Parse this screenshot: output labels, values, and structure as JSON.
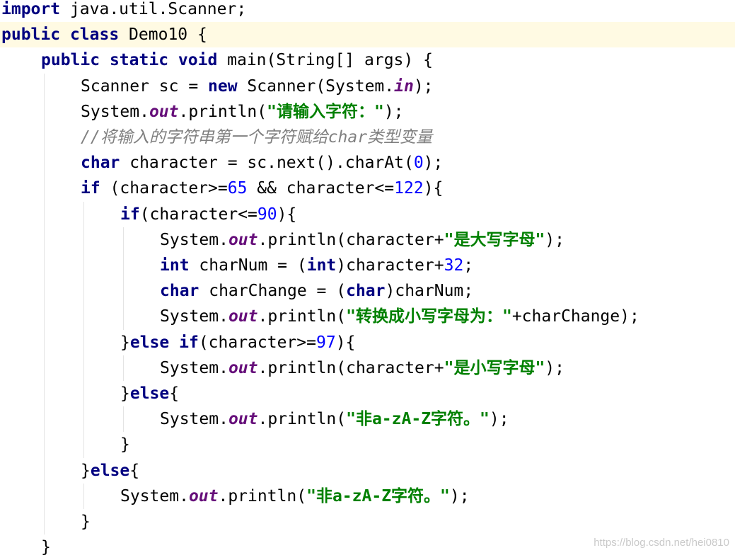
{
  "editor": {
    "lines": [
      {
        "indent": 0,
        "tokens": [
          {
            "t": "import",
            "k": "kw"
          },
          {
            "t": " java.util.Scanner;"
          }
        ]
      },
      {
        "indent": 0,
        "tokens": [
          {
            "t": "public",
            "k": "kw"
          },
          {
            "t": " "
          },
          {
            "t": "class",
            "k": "kw"
          },
          {
            "t": " Demo10 {"
          }
        ]
      },
      {
        "indent": 1,
        "tokens": [
          {
            "t": "public",
            "k": "kw"
          },
          {
            "t": " "
          },
          {
            "t": "static",
            "k": "kw"
          },
          {
            "t": " "
          },
          {
            "t": "void",
            "k": "kw"
          },
          {
            "t": " main(String[] args) {"
          }
        ]
      },
      {
        "indent": 2,
        "tokens": [
          {
            "t": "Scanner sc = "
          },
          {
            "t": "new",
            "k": "kw"
          },
          {
            "t": " Scanner(System."
          },
          {
            "t": "in",
            "k": "field"
          },
          {
            "t": ");"
          }
        ]
      },
      {
        "indent": 2,
        "tokens": [
          {
            "t": "System."
          },
          {
            "t": "out",
            "k": "field"
          },
          {
            "t": ".println("
          },
          {
            "t": "\"请输入字符：\"",
            "k": "str"
          },
          {
            "t": ");"
          }
        ]
      },
      {
        "indent": 2,
        "tokens": [
          {
            "t": "//将输入的字符串第一个字符赋给char类型变量",
            "k": "comment"
          }
        ]
      },
      {
        "indent": 2,
        "tokens": [
          {
            "t": "char",
            "k": "kw"
          },
          {
            "t": " character = sc.next().charAt("
          },
          {
            "t": "0",
            "k": "num"
          },
          {
            "t": ");"
          }
        ]
      },
      {
        "indent": 2,
        "tokens": [
          {
            "t": "if",
            "k": "kw"
          },
          {
            "t": " (character>="
          },
          {
            "t": "65",
            "k": "num"
          },
          {
            "t": " && character<="
          },
          {
            "t": "122",
            "k": "num"
          },
          {
            "t": "){"
          }
        ]
      },
      {
        "indent": 3,
        "tokens": [
          {
            "t": "if",
            "k": "kw"
          },
          {
            "t": "(character<="
          },
          {
            "t": "90",
            "k": "num"
          },
          {
            "t": "){"
          }
        ]
      },
      {
        "indent": 4,
        "tokens": [
          {
            "t": "System."
          },
          {
            "t": "out",
            "k": "field"
          },
          {
            "t": ".println(character+"
          },
          {
            "t": "\"是大写字母\"",
            "k": "str"
          },
          {
            "t": ");"
          }
        ]
      },
      {
        "indent": 4,
        "tokens": [
          {
            "t": "int",
            "k": "kw"
          },
          {
            "t": " charNum = ("
          },
          {
            "t": "int",
            "k": "kw"
          },
          {
            "t": ")character+"
          },
          {
            "t": "32",
            "k": "num"
          },
          {
            "t": ";"
          }
        ]
      },
      {
        "indent": 4,
        "tokens": [
          {
            "t": "char",
            "k": "kw"
          },
          {
            "t": " charChange = ("
          },
          {
            "t": "char",
            "k": "kw"
          },
          {
            "t": ")charNum;"
          }
        ]
      },
      {
        "indent": 4,
        "tokens": [
          {
            "t": "System."
          },
          {
            "t": "out",
            "k": "field"
          },
          {
            "t": ".println("
          },
          {
            "t": "\"转换成小写字母为：\"",
            "k": "str"
          },
          {
            "t": "+charChange);"
          }
        ]
      },
      {
        "indent": 3,
        "tokens": [
          {
            "t": "}"
          },
          {
            "t": "else",
            "k": "kw"
          },
          {
            "t": " "
          },
          {
            "t": "if",
            "k": "kw"
          },
          {
            "t": "(character>="
          },
          {
            "t": "97",
            "k": "num"
          },
          {
            "t": "){"
          }
        ]
      },
      {
        "indent": 4,
        "tokens": [
          {
            "t": "System."
          },
          {
            "t": "out",
            "k": "field"
          },
          {
            "t": ".println(character+"
          },
          {
            "t": "\"是小写字母\"",
            "k": "str"
          },
          {
            "t": ");"
          }
        ]
      },
      {
        "indent": 3,
        "tokens": [
          {
            "t": "}"
          },
          {
            "t": "else",
            "k": "kw"
          },
          {
            "t": "{"
          }
        ]
      },
      {
        "indent": 4,
        "tokens": [
          {
            "t": "System."
          },
          {
            "t": "out",
            "k": "field"
          },
          {
            "t": ".println("
          },
          {
            "t": "\"非a-zA-Z字符。\"",
            "k": "str"
          },
          {
            "t": ");"
          }
        ]
      },
      {
        "indent": 3,
        "tokens": [
          {
            "t": "}"
          }
        ]
      },
      {
        "indent": 2,
        "tokens": [
          {
            "t": "}"
          },
          {
            "t": "else",
            "k": "kw"
          },
          {
            "t": "{"
          }
        ]
      },
      {
        "indent": 3,
        "tokens": [
          {
            "t": "System."
          },
          {
            "t": "out",
            "k": "field"
          },
          {
            "t": ".println("
          },
          {
            "t": "\"非a-zA-Z字符。\"",
            "k": "str"
          },
          {
            "t": ");"
          }
        ]
      },
      {
        "indent": 2,
        "tokens": [
          {
            "t": "}"
          }
        ]
      },
      {
        "indent": 1,
        "tokens": [
          {
            "t": "}"
          }
        ]
      }
    ],
    "caret_line": 1,
    "colors": {
      "keyword": "#000080",
      "string": "#008000",
      "number": "#0000ff",
      "static_field": "#660e7a",
      "comment": "#808080",
      "caret_row_background": "#fffae3",
      "indent_guide": "#e4e4e4"
    }
  },
  "watermark": {
    "text": "https://blog.csdn.net/hei0810"
  }
}
